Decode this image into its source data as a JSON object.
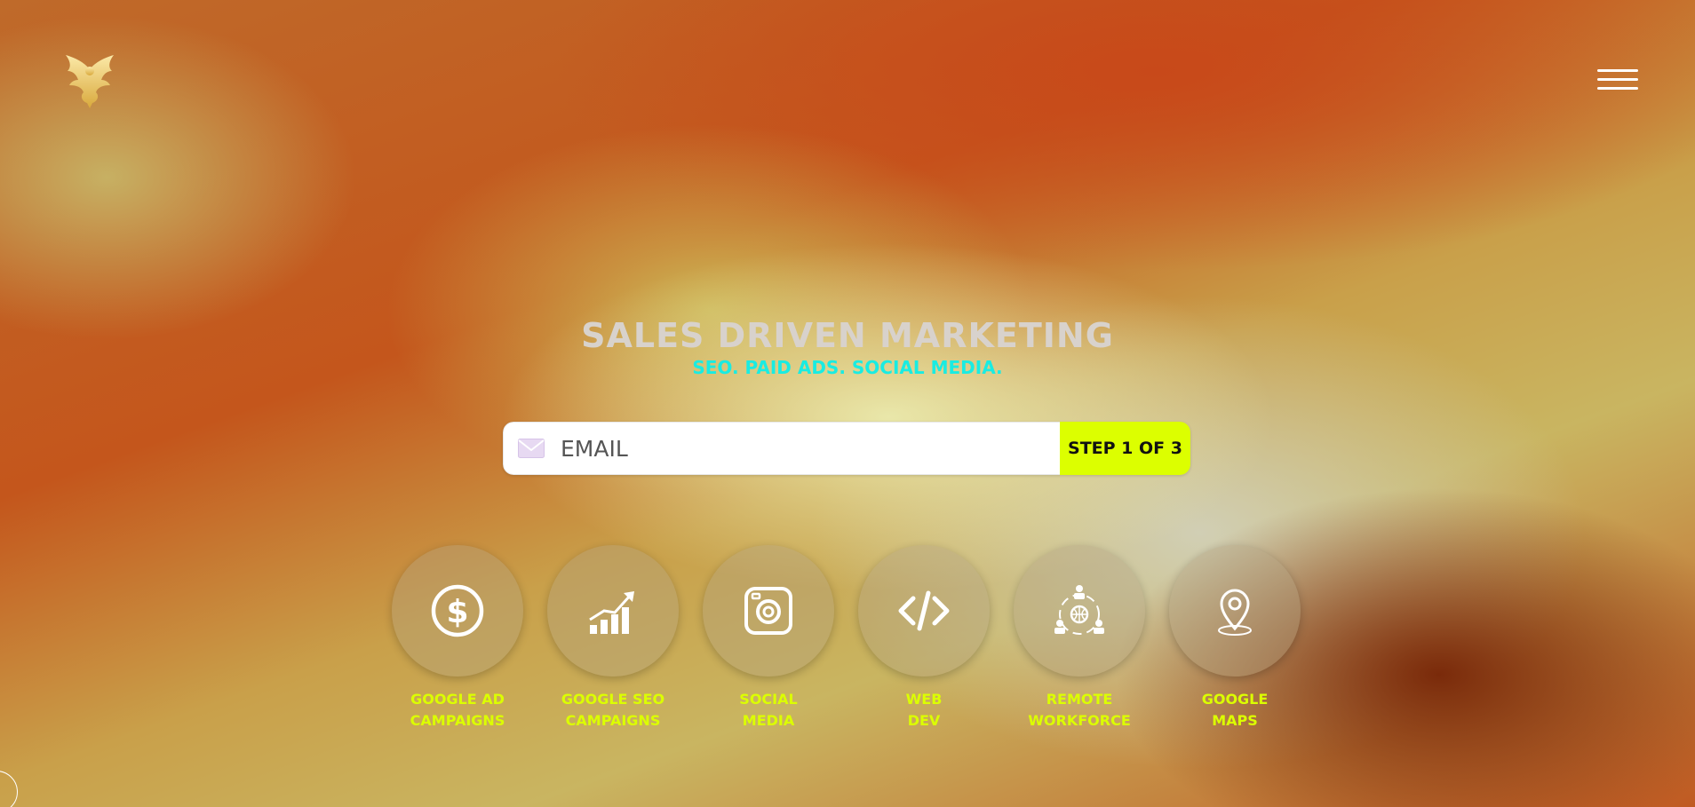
{
  "header": {
    "logo_icon": "phoenix-logo-icon",
    "menu_icon": "hamburger-menu-icon"
  },
  "hero": {
    "title": "SALES DRIVEN MARKETING",
    "subtitle": "SEO. PAID ADS. SOCIAL MEDIA."
  },
  "email_form": {
    "icon": "mail-icon",
    "placeholder": "EMAIL",
    "value": "",
    "submit_label": "STEP 1 OF 3"
  },
  "services": [
    {
      "icon": "dollar-icon",
      "line1": "GOOGLE AD",
      "line2": "CAMPAIGNS"
    },
    {
      "icon": "growth-chart-icon",
      "line1": "GOOGLE SEO",
      "line2": "CAMPAIGNS"
    },
    {
      "icon": "instagram-icon",
      "line1": "SOCIAL",
      "line2": "MEDIA"
    },
    {
      "icon": "code-icon",
      "line1": "WEB",
      "line2": "DEV"
    },
    {
      "icon": "remote-team-globe-icon",
      "line1": "REMOTE",
      "line2": "WORKFORCE"
    },
    {
      "icon": "map-pin-icon",
      "line1": "GOOGLE",
      "line2": "MAPS"
    }
  ],
  "colors": {
    "accent_yellow": "#dcff00",
    "subtitle_cyan": "#19ece2",
    "title_gray": "#d8d2cc",
    "logo_gold": "#f2d37a"
  }
}
